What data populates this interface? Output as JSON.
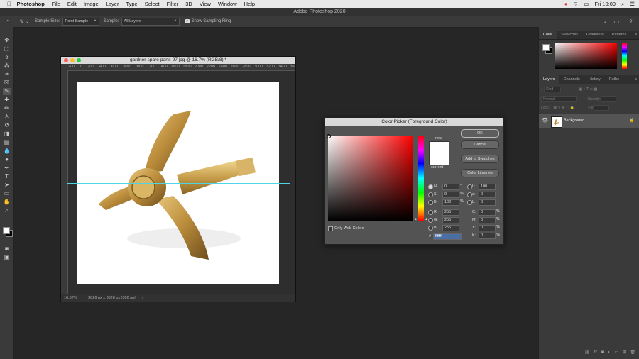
{
  "menubar": {
    "apple": "",
    "app": "Photoshop",
    "items": [
      "File",
      "Edit",
      "Image",
      "Layer",
      "Type",
      "Select",
      "Filter",
      "3D",
      "View",
      "Window",
      "Help"
    ],
    "clock": "Fri 10:09"
  },
  "window_title": "Adobe Photoshop 2020",
  "options_bar": {
    "sample_size_label": "Sample Size:",
    "sample_size_value": "Point Sample",
    "sample_label": "Sample:",
    "sample_value": "All Layers",
    "show_ring_label": "Show Sampling Ring",
    "show_ring_checked": true
  },
  "document": {
    "title": "gardner-spare-parts-97.jpg @ 16.7% (RGB/8) *",
    "ruler_marks": [
      "200",
      "0",
      "200",
      "400",
      "600",
      "800",
      "1000",
      "1200",
      "1400",
      "1600",
      "1800",
      "2000",
      "2200",
      "2400",
      "2600",
      "2800",
      "3000",
      "3200",
      "3400",
      "3600",
      "3800"
    ],
    "zoom": "16.67%",
    "doc_size": "3826 px x 3826 px (300 ppi)"
  },
  "color_picker": {
    "title": "Color Picker (Foreground Color)",
    "new_label": "new",
    "current_label": "current",
    "buttons": {
      "ok": "OK",
      "cancel": "Cancel",
      "add_swatches": "Add to Swatches",
      "color_libraries": "Color Libraries"
    },
    "only_web_label": "Only Web Colors",
    "fields": {
      "H": "0",
      "S": "0",
      "B": "100",
      "R": "255",
      "G": "255",
      "Bl": "255",
      "L": "100",
      "a": "0",
      "b": "0",
      "C": "0",
      "M": "0",
      "Y": "0",
      "K": "0"
    },
    "units": {
      "deg": "°",
      "pct": "%"
    },
    "hex_label": "#",
    "hex": "ffffff",
    "new_color": "#ffffff"
  },
  "panels": {
    "top_tabs": [
      "Color",
      "Swatches",
      "Gradients",
      "Patterns"
    ],
    "layer_tabs": [
      "Layers",
      "Channels",
      "History",
      "Paths"
    ],
    "kind_label": "Kind",
    "blend_mode": "Normal",
    "opacity_label": "Opacity:",
    "lock_label": "Lock:",
    "fill_label": "Fill:",
    "layer_name": "Background"
  }
}
